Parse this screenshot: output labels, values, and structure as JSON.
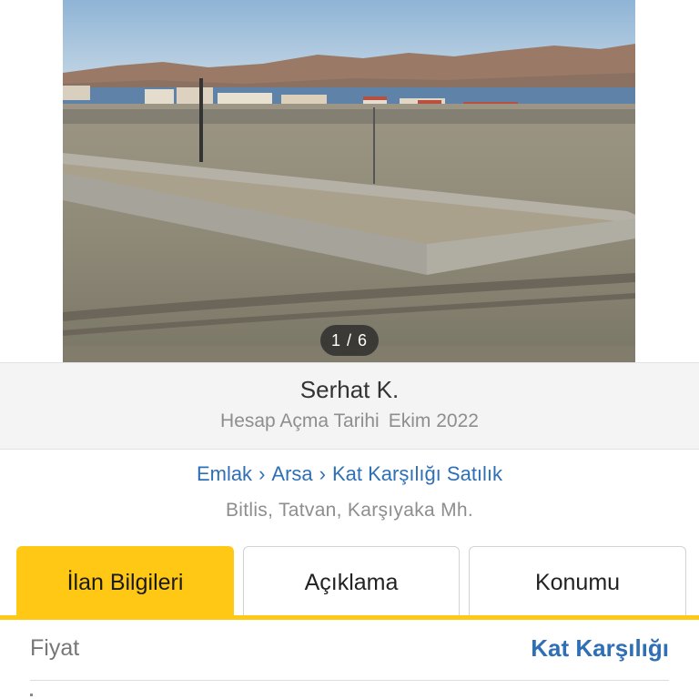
{
  "gallery": {
    "counter": "1 / 6"
  },
  "seller": {
    "name": "Serhat K.",
    "since_label": "Hesap Açma Tarihi",
    "since_value": "Ekim 2022"
  },
  "breadcrumb": {
    "items": [
      "Emlak",
      "Arsa",
      "Kat Karşılığı Satılık"
    ],
    "separator": "›"
  },
  "location": "Bitlis, Tatvan, Karşıyaka Mh.",
  "tabs": [
    {
      "label": "İlan Bilgileri",
      "active": true
    },
    {
      "label": "Açıklama",
      "active": false
    },
    {
      "label": "Konumu",
      "active": false
    }
  ],
  "details": {
    "price_label": "Fiyat",
    "price_value": "Kat Karşılığı"
  },
  "colors": {
    "accent": "#ffc814",
    "link": "#2f6fb5"
  }
}
